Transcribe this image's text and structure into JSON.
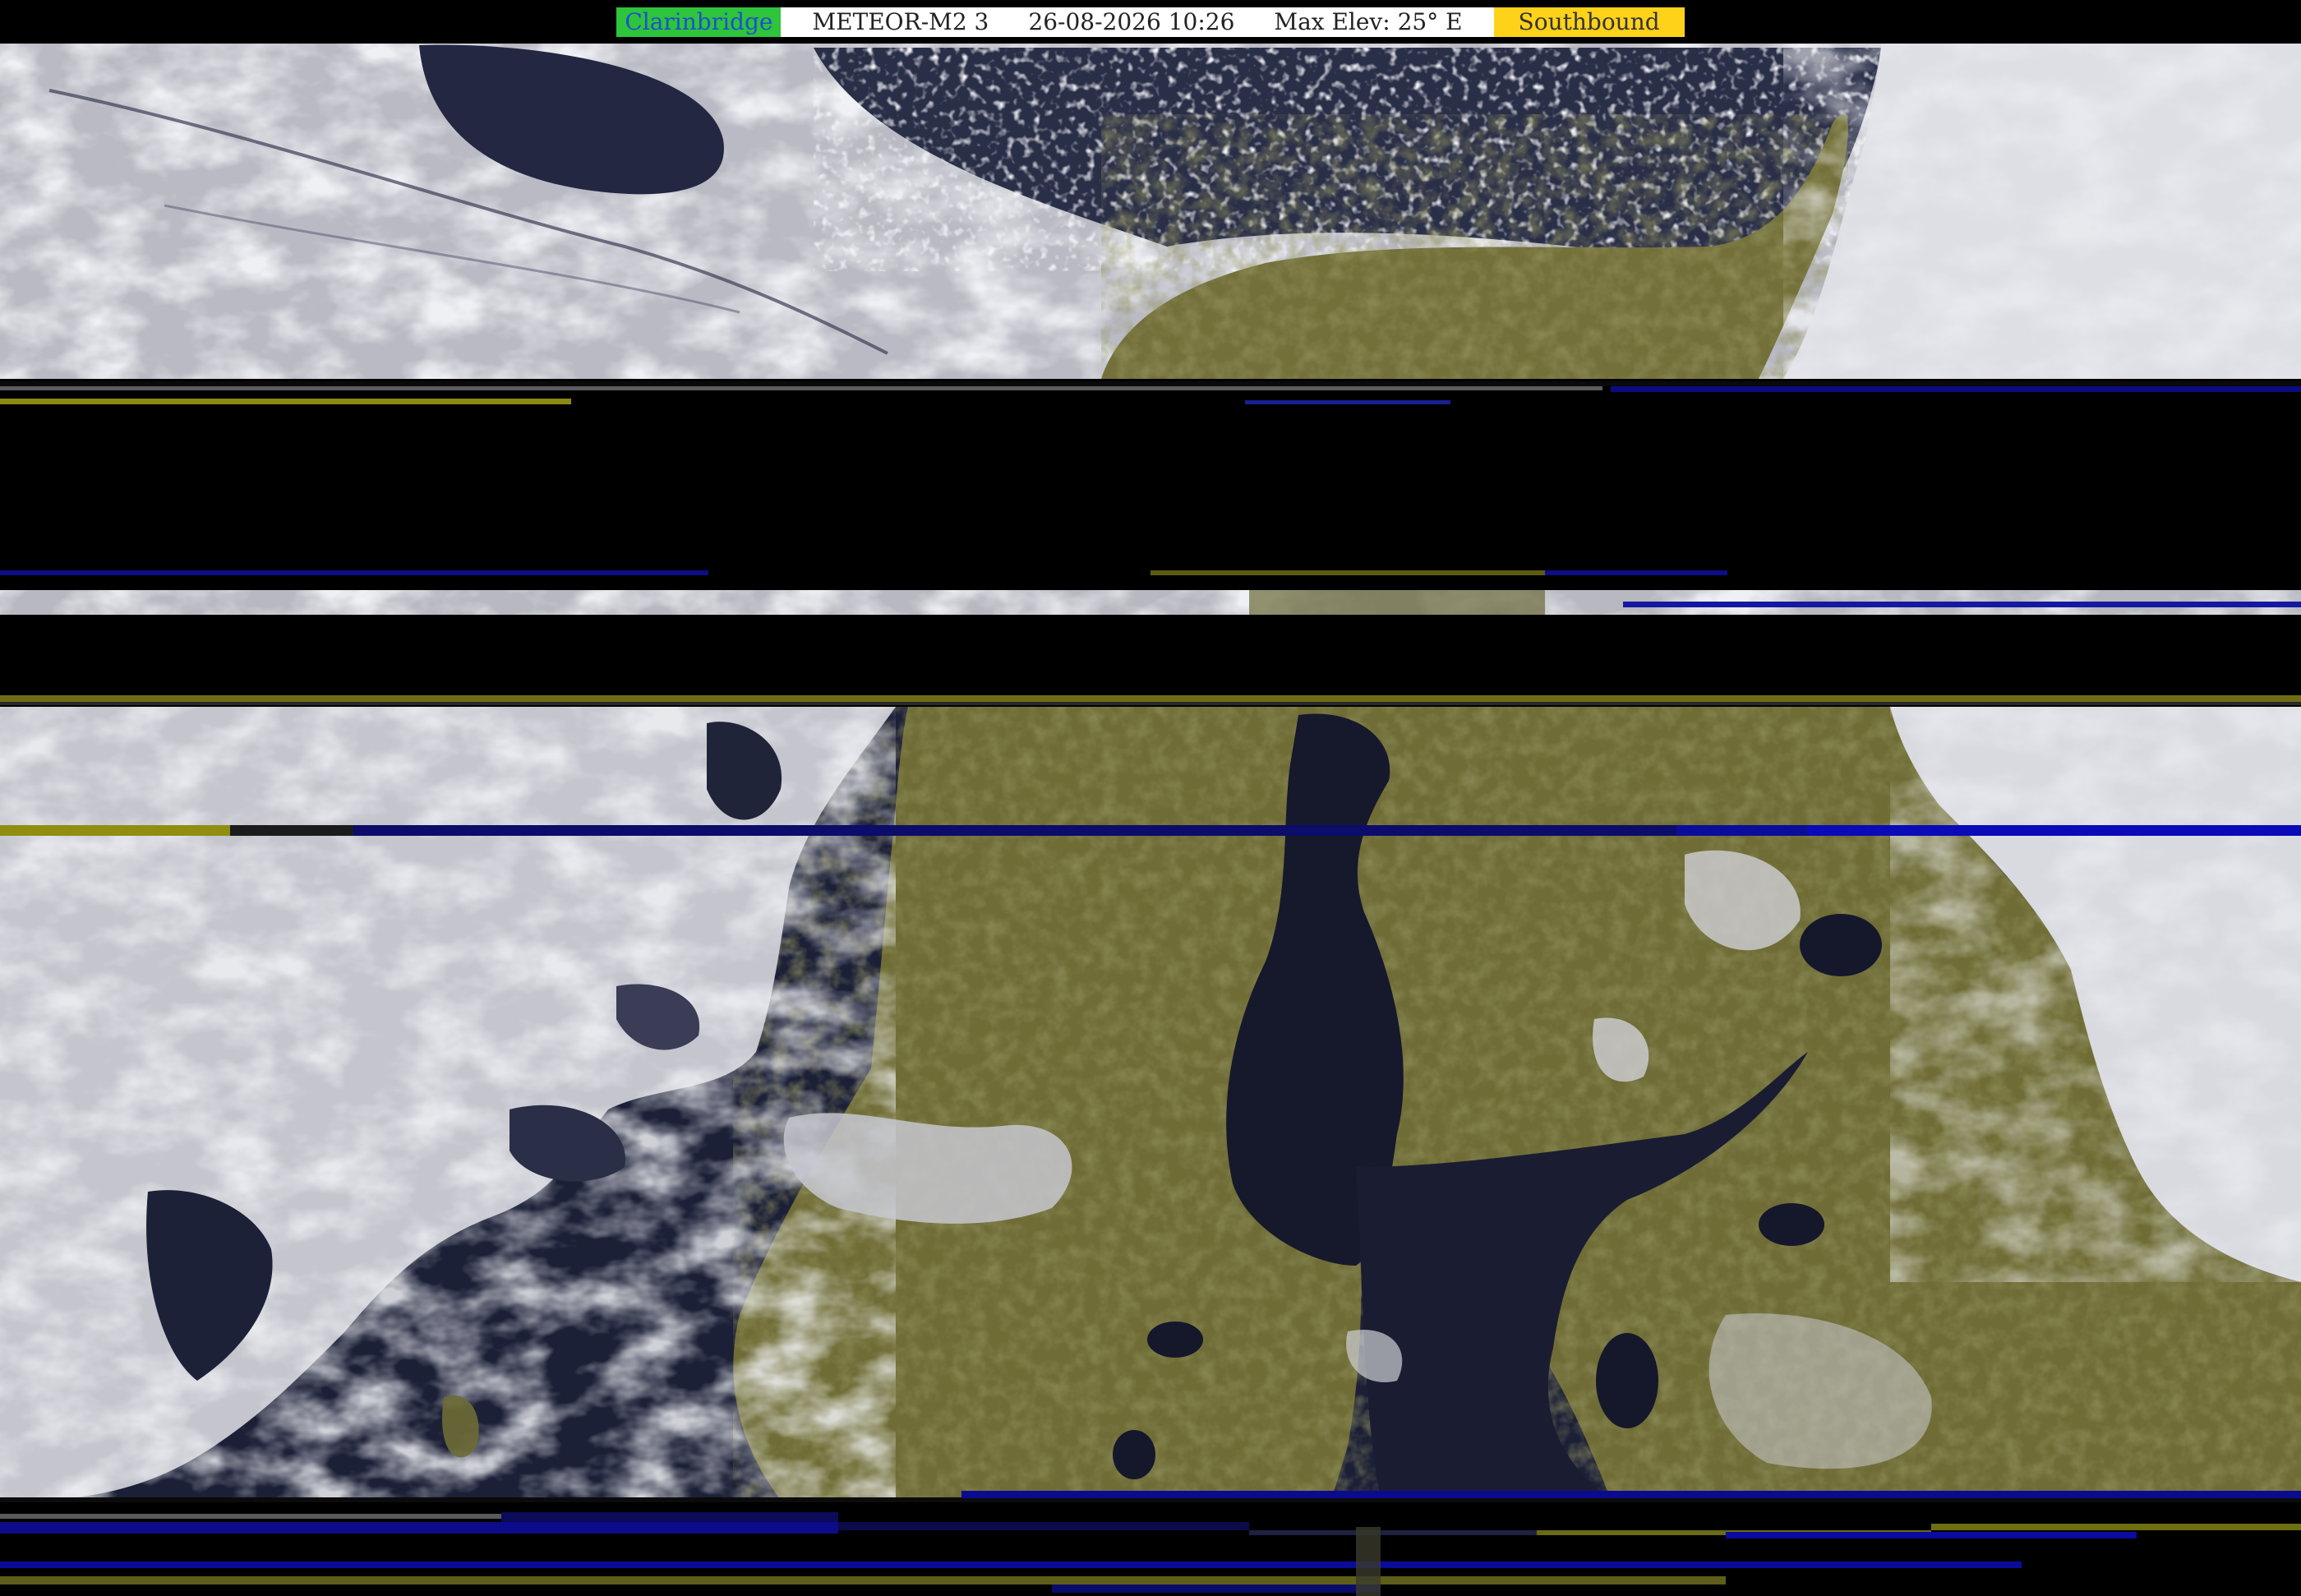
{
  "header": {
    "station": "Clarinbridge",
    "satellite": "METEOR-M2 3",
    "datetime": "26-08-2026 10:26",
    "max_elevation": "Max Elev: 25° E",
    "direction": "Southbound"
  },
  "colors": {
    "station_bg": "#2ec43c",
    "station_text": "#1f4fd0",
    "direction_bg": "#ffd21a",
    "ocean": "#1a1e34",
    "land": "#6f6c36",
    "cloud": "#d7d8de"
  }
}
